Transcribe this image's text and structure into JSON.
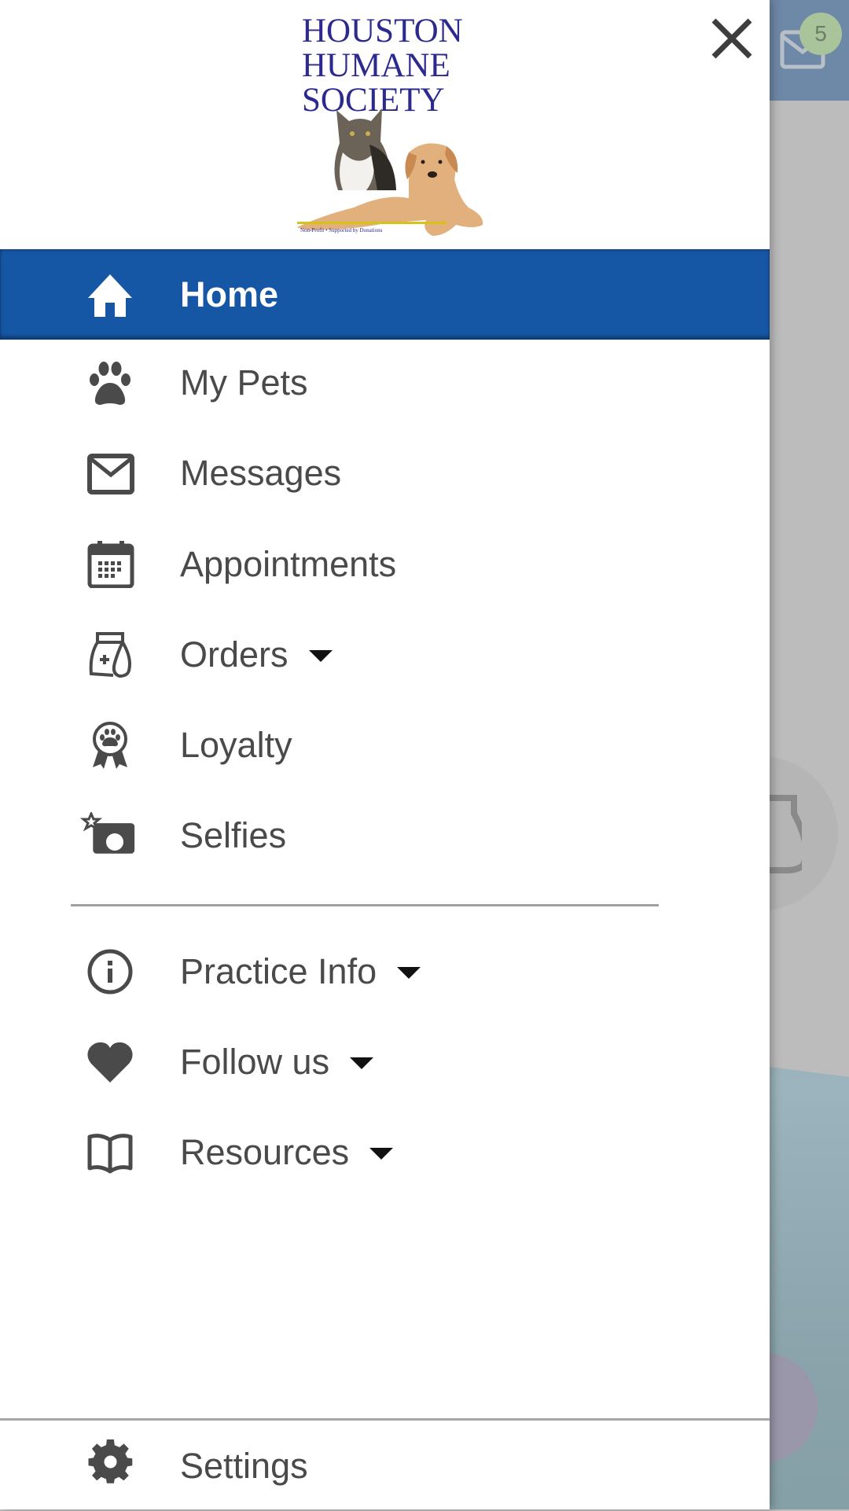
{
  "background_app": {
    "messages_badge_count": "5"
  },
  "drawer": {
    "logo": {
      "line1": "HOUSTON",
      "line2": "HUMANE",
      "line3": "SOCIETY",
      "tagline": "Non-Profit • Supported by Donations"
    },
    "close_icon": "close-icon",
    "colors": {
      "active_bg": "#1556a5",
      "text": "#4a4a4a",
      "logo": "#2c2a8f"
    },
    "items": [
      {
        "label": "Home",
        "icon": "home-icon",
        "active": true,
        "has_dropdown": false
      },
      {
        "label": "My Pets",
        "icon": "paw-icon",
        "active": false,
        "has_dropdown": false
      },
      {
        "label": "Messages",
        "icon": "envelope-icon",
        "active": false,
        "has_dropdown": false
      },
      {
        "label": "Appointments",
        "icon": "calendar-icon",
        "active": false,
        "has_dropdown": false
      },
      {
        "label": "Orders",
        "icon": "food-bag-icon",
        "active": false,
        "has_dropdown": true
      },
      {
        "label": "Loyalty",
        "icon": "paw-ribbon-icon",
        "active": false,
        "has_dropdown": false
      },
      {
        "label": "Selfies",
        "icon": "camera-star-icon",
        "active": false,
        "has_dropdown": false
      }
    ],
    "secondary_items": [
      {
        "label": "Practice Info",
        "icon": "info-icon",
        "has_dropdown": true
      },
      {
        "label": "Follow us",
        "icon": "heart-icon",
        "has_dropdown": true
      },
      {
        "label": "Resources",
        "icon": "book-icon",
        "has_dropdown": true
      }
    ],
    "footer_item": {
      "label": "Settings",
      "icon": "gear-icon"
    }
  }
}
